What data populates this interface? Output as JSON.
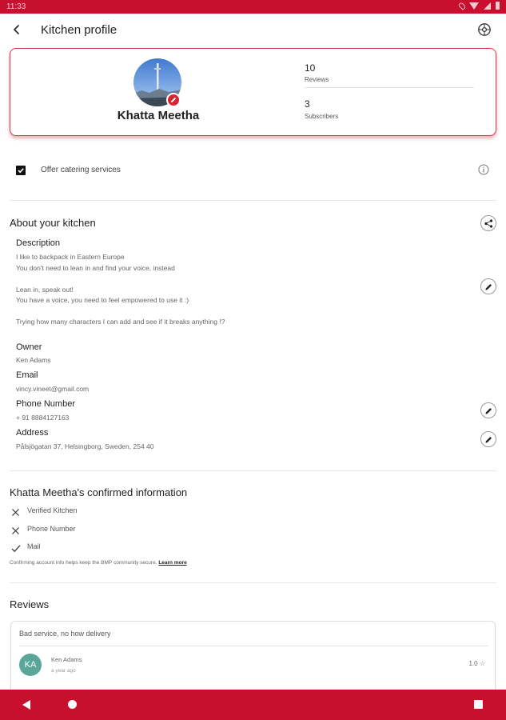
{
  "status_bar": {
    "time": "11:33"
  },
  "app_bar": {
    "title": "Kitchen profile"
  },
  "profile": {
    "name": "Khatta Meetha",
    "stats": [
      {
        "value": "10",
        "label": "Reviews"
      },
      {
        "value": "3",
        "label": "Subscribers"
      }
    ]
  },
  "catering": {
    "label": "Offer catering services",
    "checked": true
  },
  "about": {
    "title": "About your kitchen",
    "description_label": "Description",
    "description_text": "I like to backpack in Eastern Europe\nYou don't need to lean in and find your voice, instead\n\nLean in, speak out!\nYou have a voice, you need to feel empowered to use it :)\n\nTrying how many characters I can add and see if it breaks anything !?",
    "owner_label": "Owner",
    "owner_value": "Ken Adams",
    "email_label": "Email",
    "email_value": "vincy.vineet@gmail.com",
    "phone_label": "Phone Number",
    "phone_value": "+ 91 8884127163",
    "address_label": "Address",
    "address_value": "Pålsjögatan 37, Helsingborg, Sweden, 254 40"
  },
  "confirmed": {
    "title": "Khatta Meetha's confirmed information",
    "items": [
      {
        "label": "Verified Kitchen",
        "status": "no"
      },
      {
        "label": "Phone Number",
        "status": "no"
      },
      {
        "label": "Mail",
        "status": "yes"
      }
    ],
    "note": "Confirming account info helps keep the BMP community secure.",
    "learn_more": "Learn more"
  },
  "reviews": {
    "title": "Reviews",
    "items": [
      {
        "text": "Bad service, no how delivery",
        "initials": "KA",
        "reviewer": "Ken Adams",
        "time": "a year ago",
        "rating": "1.0"
      }
    ]
  },
  "colors": {
    "accent": "#c8102e",
    "avatar_bg": "#5aa79a"
  }
}
